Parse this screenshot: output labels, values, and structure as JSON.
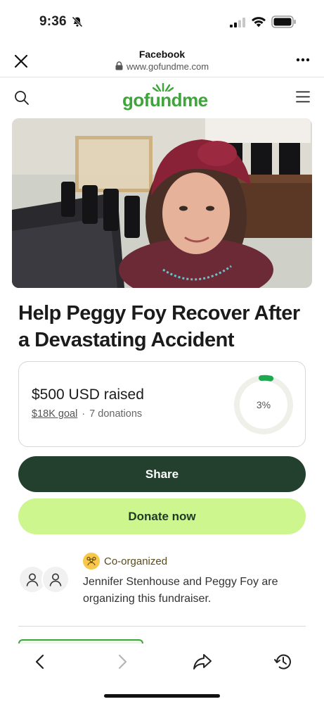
{
  "status_bar": {
    "time": "9:36"
  },
  "browser": {
    "title": "Facebook",
    "url": "www.gofundme.com"
  },
  "site": {
    "logo_text": "gofundme",
    "brand_color": "#3ea53a"
  },
  "campaign": {
    "title": "Help Peggy Foy Recover After a Devastating Accident",
    "raised": "$500 USD raised",
    "goal": "$18K goal",
    "separator": "·",
    "donations": "7 donations",
    "progress_label": "3%",
    "progress_fraction": 0.03
  },
  "buttons": {
    "share": "Share",
    "donate": "Donate now"
  },
  "organizers": {
    "badge": "Co-organized",
    "text": "Jennifer Stenhouse and Peggy Foy are organizing this fundraiser."
  },
  "colors": {
    "share_button": "#22402d",
    "donate_button": "#cdf68f",
    "progress_arc": "#1fa84f",
    "progress_track": "#f0f0ea"
  }
}
